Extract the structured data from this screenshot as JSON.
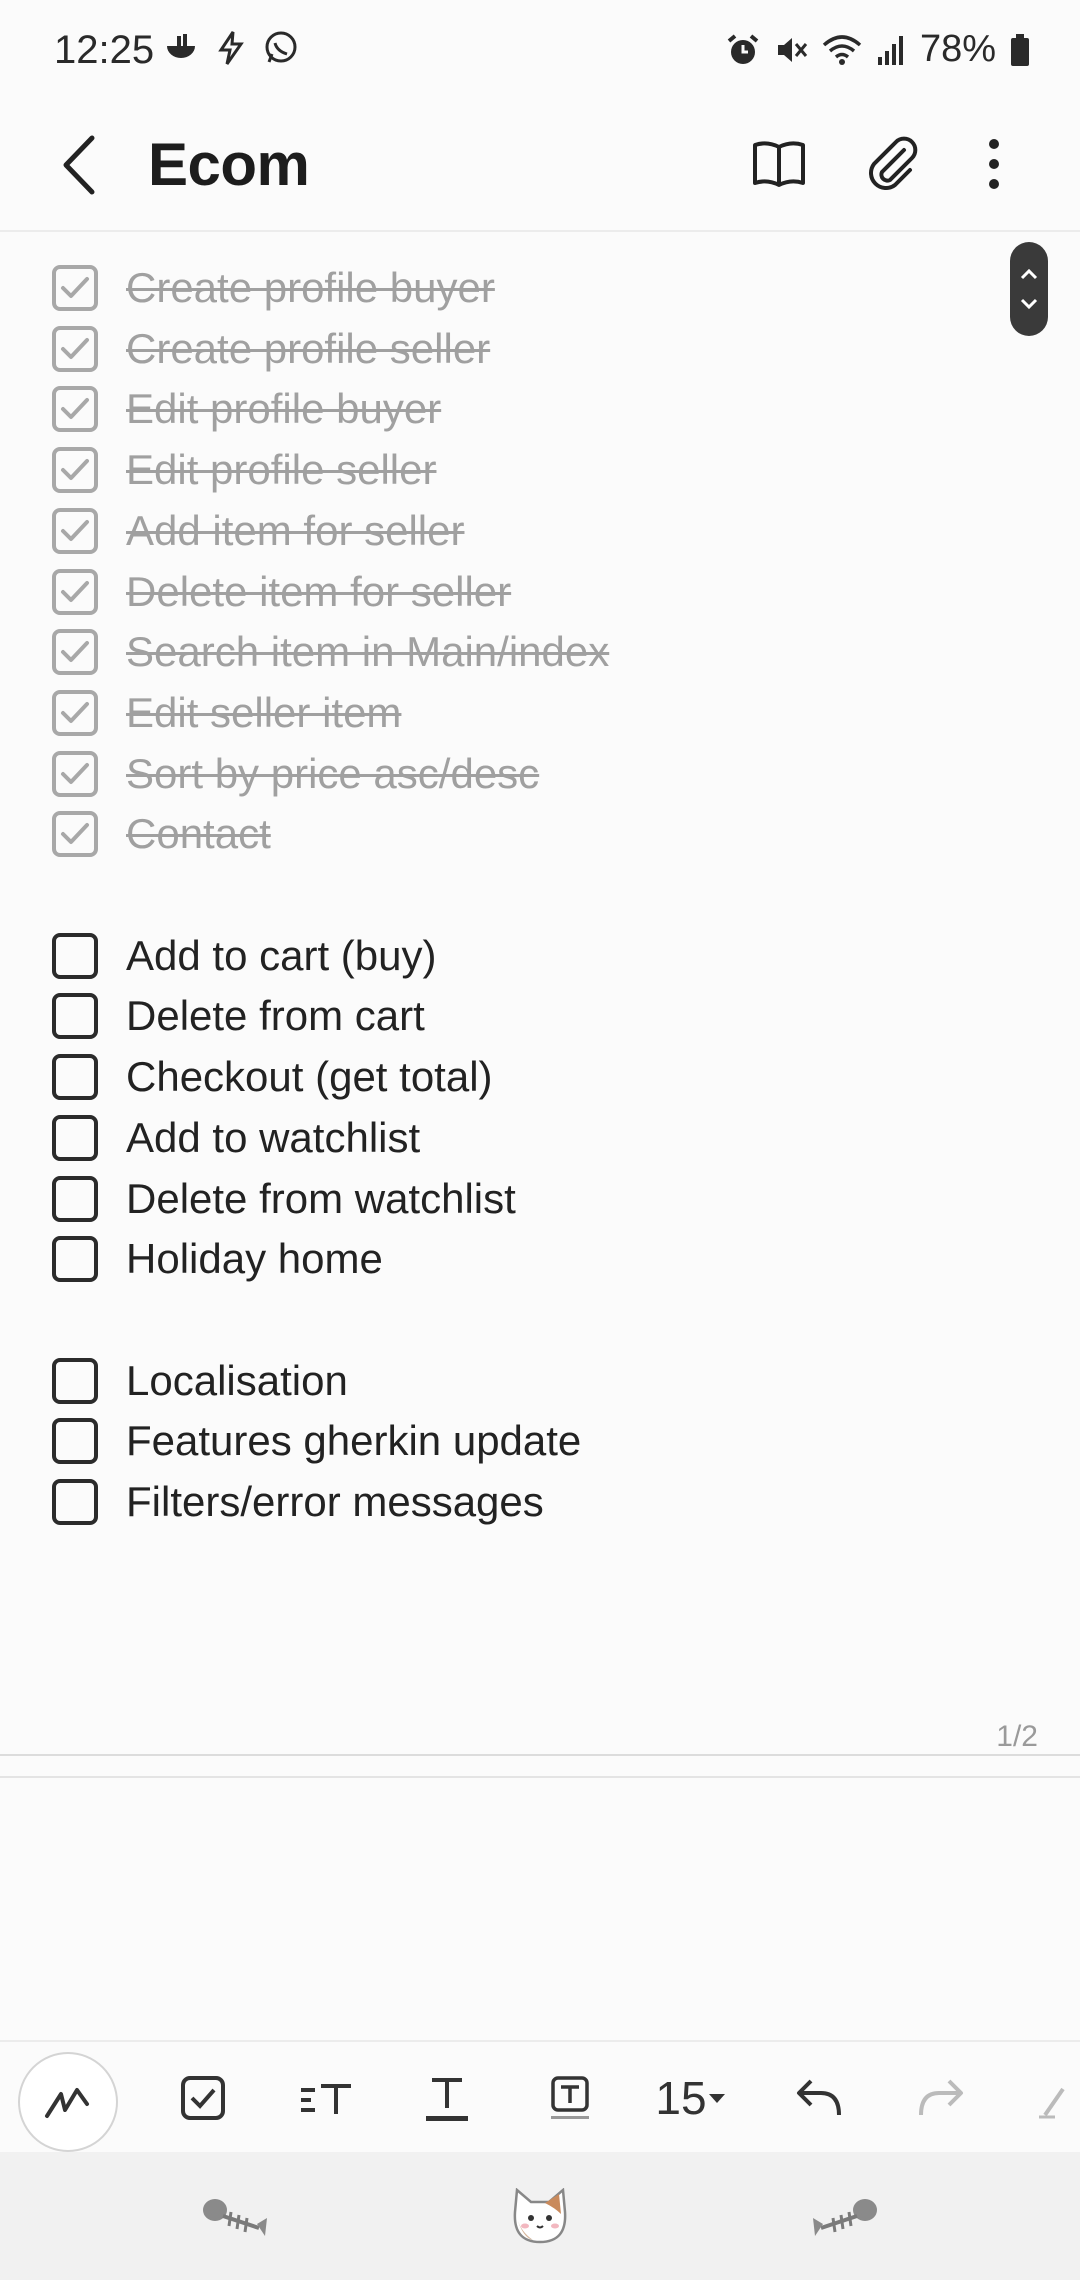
{
  "status_bar": {
    "time": "12:25",
    "battery": "78%",
    "left_icons": [
      "food-icon",
      "lightning-icon",
      "whatsapp-icon"
    ],
    "right_icons": [
      "alarm-icon",
      "mute-icon",
      "wifi-icon",
      "signal-icon",
      "battery-icon"
    ]
  },
  "header": {
    "title": "Ecom",
    "actions": [
      "back-icon",
      "book-icon",
      "paperclip-icon",
      "more-options-icon"
    ]
  },
  "checklist": {
    "groups": [
      {
        "items": [
          {
            "label": "Create profile buyer",
            "checked": true
          },
          {
            "label": "Create profile seller",
            "checked": true
          },
          {
            "label": "Edit profile buyer",
            "checked": true
          },
          {
            "label": "Edit profile seller",
            "checked": true
          },
          {
            "label": "Add item for seller",
            "checked": true
          },
          {
            "label": "Delete item for seller",
            "checked": true
          },
          {
            "label": "Search item in Main/index",
            "checked": true
          },
          {
            "label": "Edit seller item",
            "checked": true
          },
          {
            "label": "Sort by price asc/desc",
            "checked": true
          },
          {
            "label": "Contact",
            "checked": true
          }
        ]
      },
      {
        "items": [
          {
            "label": "Add to cart (buy)",
            "checked": false
          },
          {
            "label": "Delete from cart",
            "checked": false
          },
          {
            "label": "Checkout (get total)",
            "checked": false
          },
          {
            "label": "Add to watchlist",
            "checked": false
          },
          {
            "label": "Delete from watchlist",
            "checked": false
          },
          {
            "label": "Holiday home",
            "checked": false
          }
        ]
      },
      {
        "items": [
          {
            "label": "Localisation",
            "checked": false
          },
          {
            "label": "Features gherkin update",
            "checked": false
          },
          {
            "label": "Filters/error messages",
            "checked": false
          }
        ]
      }
    ]
  },
  "page_indicator": "1/2",
  "toolbar": {
    "font_size": "15",
    "tools": [
      "pen-icon",
      "checkbox-icon",
      "text-style-icon",
      "underline-text-icon",
      "text-box-icon",
      "undo-icon",
      "redo-icon",
      "eraser-icon"
    ]
  },
  "bottom_bar": {
    "items": [
      "fishbone-icon",
      "cat-icon",
      "fishbone-icon"
    ]
  },
  "colors": {
    "checked_text": "#a0a0a0",
    "text": "#222222",
    "background": "#fbfbfb"
  }
}
